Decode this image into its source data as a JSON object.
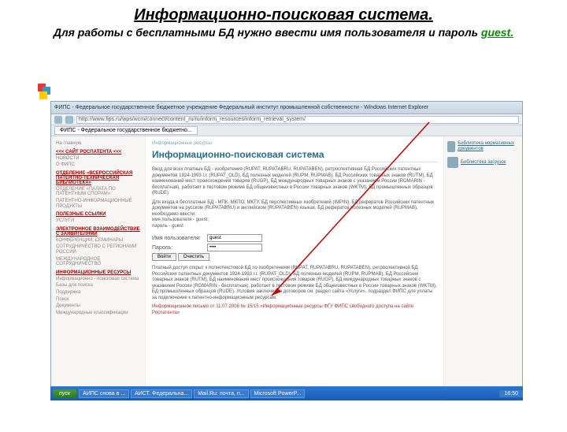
{
  "slide": {
    "title": "Информационно-поисковая система.",
    "sub_before": "Для работы с бесплатными БД нужно ввести имя пользователя и пароль  ",
    "sub_guest": "guest.",
    "guest_color": "#0a8a0a"
  },
  "browser": {
    "window_title": "ФИПС - Федеральное государственное бюджетное учреждение Федеральный институт промышленной собственности - Windows Internet Explorer",
    "url": "http://www.fips.ru/wps/wcm/connect/content_ru/ru/inform_resources/inform_retrieval_system/",
    "tab": "ФИПС - Федеральное государственное бюджетно..."
  },
  "sidebar": {
    "items": [
      "На главную",
      "<<< САЙТ РОСПАТЕНТА <<<",
      "НОВОСТИ",
      "О ФИПС",
      "ОТДЕЛЕНИЕ «ВСЕРОССИЙСКАЯ ПАТЕНТНО-ТЕХНИЧЕСКАЯ БИБЛИОТЕКА»",
      "ОТДЕЛЕНИЕ «ПАЛАТА ПО ПАТЕНТНЫМ СПОРАМ»",
      "ПАТЕНТНО-ИНФОРМАЦИОННЫЕ ПРОДУКТЫ",
      "ПОЛЕЗНЫЕ ССЫЛКИ",
      "УСЛУГИ",
      "ЭЛЕКТРОННОЕ ВЗАИМОДЕЙСТВИЕ С ЗАЯВИТЕЛЯМИ",
      "КОНФЕРЕНЦИИ, СЕМИНАРЫ",
      "СОТРУДНИЧЕСТВО С РЕГИОНАМИ РОССИИ",
      "МЕЖДУНАРОДНОЕ СОТРУДНИЧЕСТВО",
      "ИНФОРМАЦИОННЫЕ РЕСУРСЫ"
    ],
    "sub": [
      "Информационно - поисковая система",
      "Базы для поиска",
      "Поддержка",
      "Поиск",
      "Документы",
      "Международные классификации"
    ]
  },
  "page": {
    "breadcrumb": "Информационные ресурсы",
    "h1": "Информационно-поисковая система",
    "intro1": "Вход для всех платных БД - изобретения (RUPAT, RUPATABRU, RUPATABEN), ретроспективная БД Российских патентных документов 1924-1993 г.г. (RUPAT_OLD), БД полезных моделей (RUPM, RUPMAB), БД Российских товарных знаков (RUTM), БД наименований мест происхождения товаров (RUGP), БД международных товарных знаков с указанием России (ROMARIN - бесплатная), работает в тестовом режиме БД общеизвестных в России товарных знаков (WKTM), БД промышленных образцов (RUDE)",
    "intro2": "Для входа в бесплатные БД - МПК, МКПО, МКТУ, БД перспективных изобретений (IMPIN), БД рефератов Российских патентных документов на русском (RUPATABRU) и английском (RUPATABEN) языках, БД рефератов полезных моделей (RUPMAB), необходимо ввести:",
    "cred1": "имя пользователя - guest;",
    "cred2": "пароль             - guest",
    "form": {
      "user_label": "Имя пользователя:",
      "pass_label": "Пароль:",
      "user_value": "guest",
      "pass_value": "****",
      "login_btn": "Войти",
      "reset_btn": "Очистить"
    },
    "paid": "Платный доступ открыт к полнотекстовой БД по изобретениям (RUPAT, RUPATABRU, RUPATABEN), ретроспективной БД Российских патентных документов 1924-1993 г.г. (RUPAT_OLD), БД полезных моделей (RUPM, RUPMAB), БД Российских товарных знаков (RUTM), БД наименований мест происхождения товаров (RUGP), БД международных товарных знаков с указанием России (ROMARIN - бесплатная), работает в тестовом режиме БД общеизвестных в России товарных знаков (WKTM), БД промышленных образцов (RUDE). Условия заключения договоров см. раздел сайта «Услуги», подраздел ФИПС для уплаты за подключение к патентно-информационным ресурсам.",
    "news": "Информационное письмо от 11.07.2008 № 15/15 «Информационные ресурсы ФГУ ФИПС свободного доступа на сайте Роспатента»"
  },
  "rightboxes": [
    "Библиотека нормативных документов",
    "Библиотека загрузок"
  ],
  "taskbar": {
    "start": "пуск",
    "items": [
      "АИПС снова в ...",
      "АИСТ. Федеральна...",
      "Mail.Ru: почта, п...",
      "Microsoft PowerP..."
    ],
    "tray_time": "16:50"
  }
}
